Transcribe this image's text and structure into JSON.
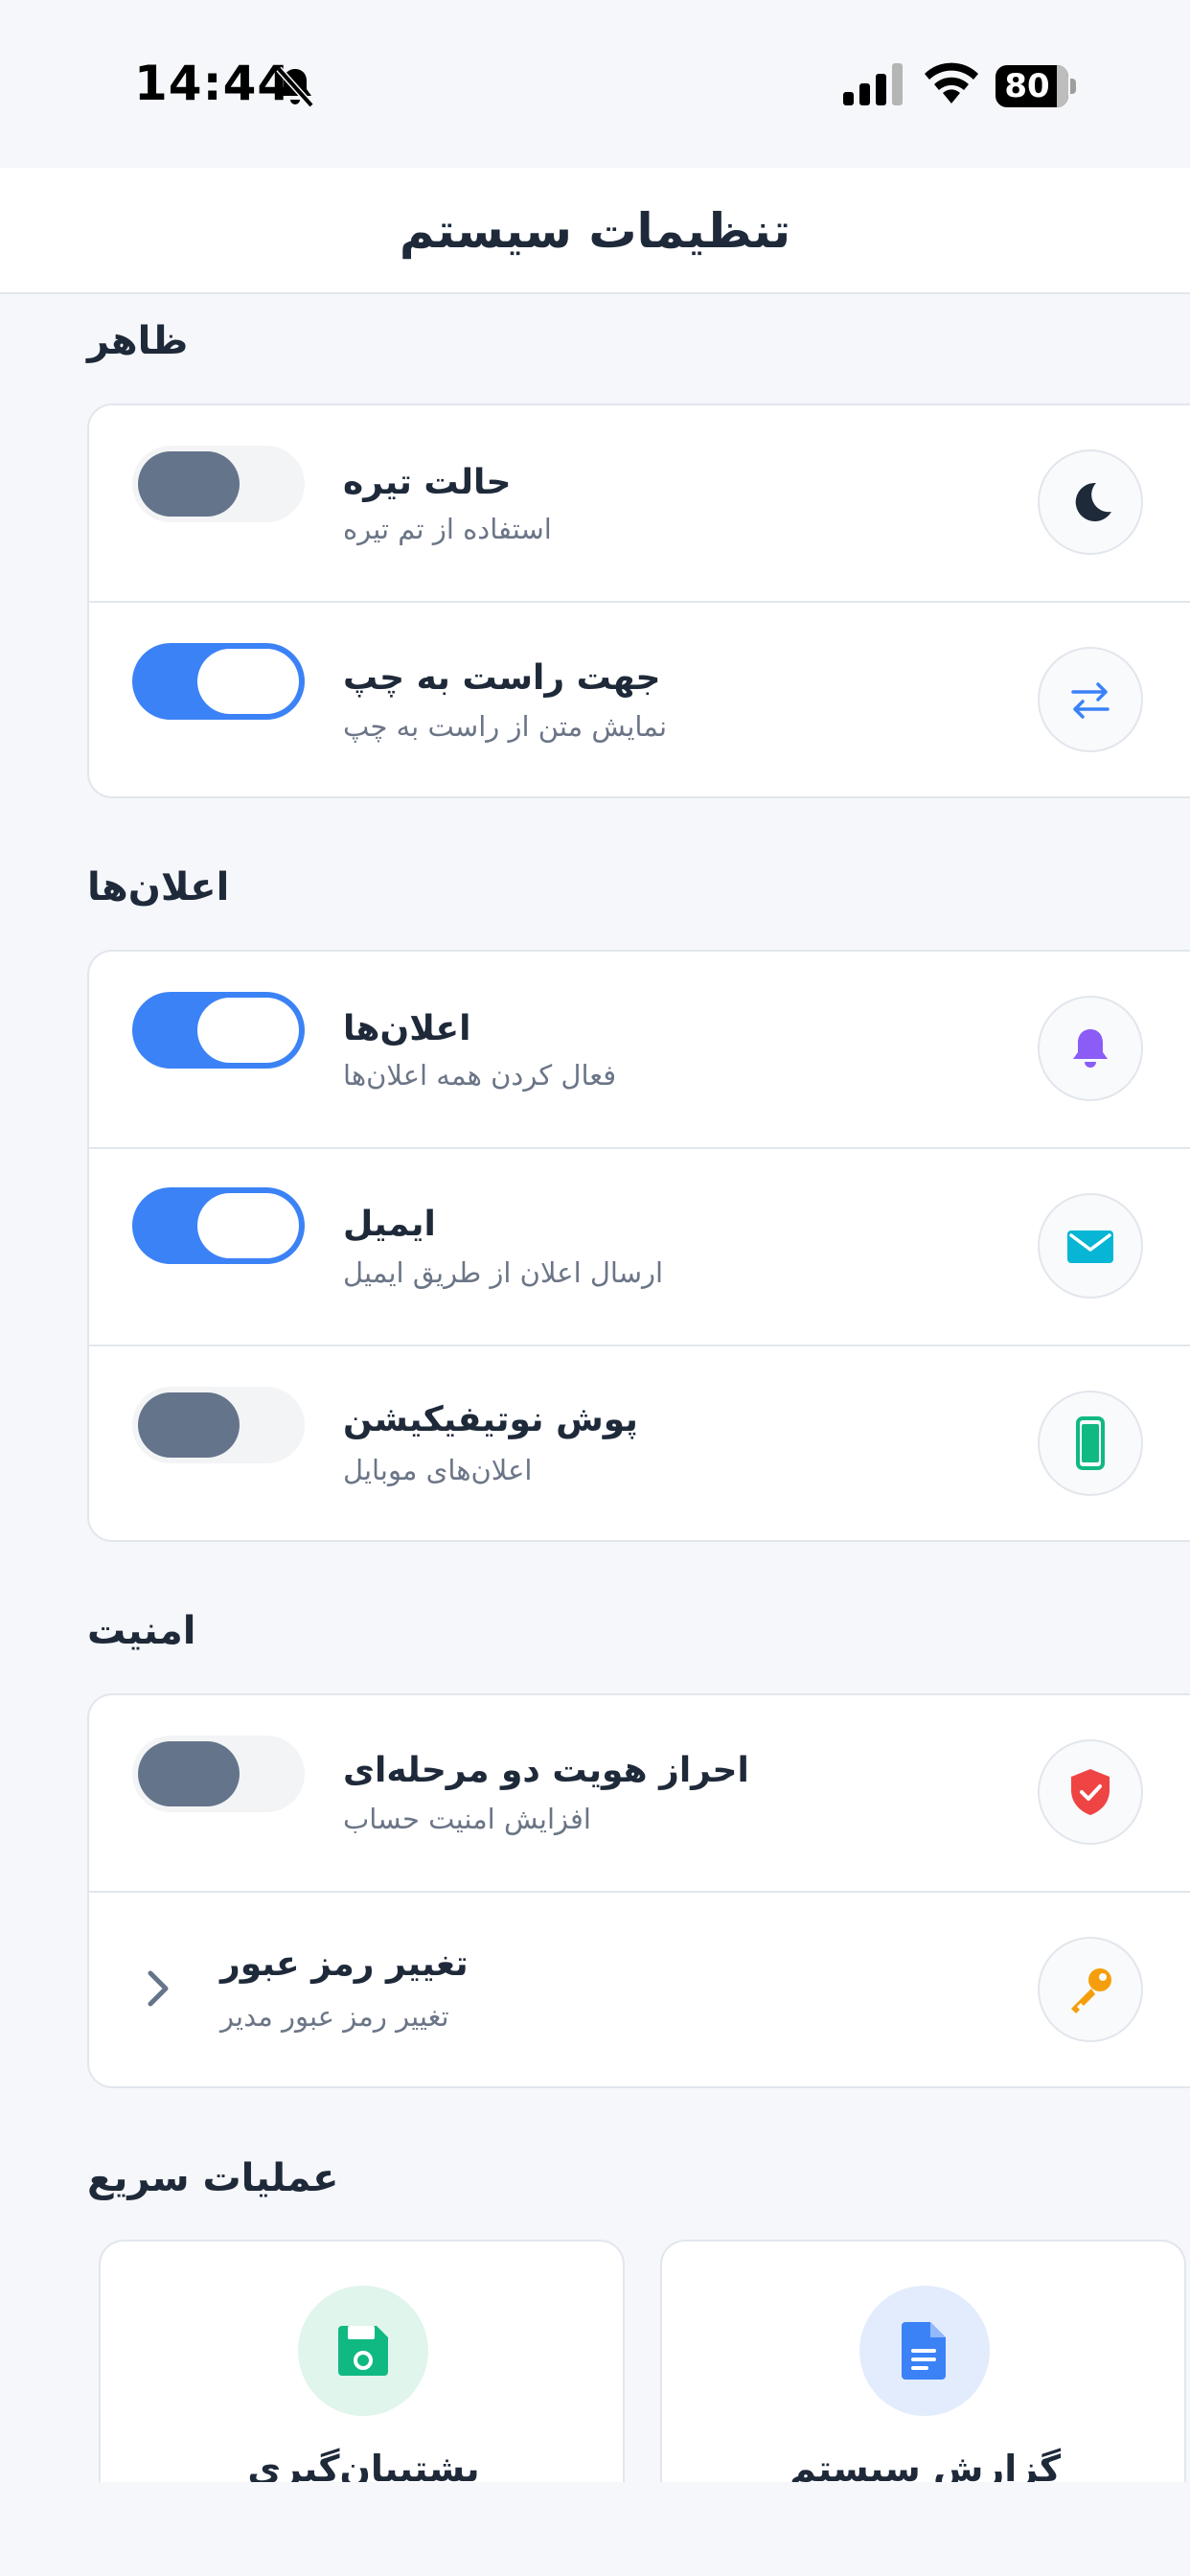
{
  "status_bar": {
    "time": "14:44",
    "battery": "80",
    "icons": [
      "bell-off-icon",
      "signal-icon",
      "wifi-icon",
      "battery-icon"
    ]
  },
  "header": {
    "title": "تنظیمات سیستم"
  },
  "appearance": {
    "title": "ظاهر",
    "items": [
      {
        "title": "حالت تیره",
        "subtitle": "استفاده از تم تیره",
        "icon": "moon-icon",
        "toggle_on": false,
        "icon_color": "#1e2939"
      },
      {
        "title": "جهت راست به چپ",
        "subtitle": "نمایش متن از راست به چپ",
        "icon": "swap-arrows-icon",
        "toggle_on": true,
        "icon_color": "#3b82f6"
      }
    ]
  },
  "notifications": {
    "title": "اعلان‌ها",
    "items": [
      {
        "title": "اعلان‌ها",
        "subtitle": "فعال کردن همه اعلان‌ها",
        "icon": "bell-icon",
        "toggle_on": true,
        "icon_color": "#8b5cf6"
      },
      {
        "title": "ایمیل",
        "subtitle": "ارسال اعلان از طریق ایمیل",
        "icon": "mail-icon",
        "toggle_on": true,
        "icon_color": "#06b6d4"
      },
      {
        "title": "پوش نوتیفیکیشن",
        "subtitle": "اعلان‌های موبایل",
        "icon": "mobile-icon",
        "toggle_on": false,
        "icon_color": "#10b981"
      }
    ]
  },
  "security": {
    "title": "امنیت",
    "items": [
      {
        "title": "احراز هویت دو مرحله‌ای",
        "subtitle": "افزایش امنیت حساب",
        "icon": "shield-check-icon",
        "toggle_on": false,
        "icon_color": "#ef4444"
      },
      {
        "title": "تغییر رمز عبور",
        "subtitle": "تغییر رمز عبور مدیر",
        "icon": "key-icon",
        "icon_color": "#f59e0b",
        "action": "chevron-left-icon"
      }
    ]
  },
  "quick_actions": {
    "title": "عملیات سریع",
    "items": [
      {
        "label": "گزارش سیستم",
        "icon": "document-icon",
        "icon_color": "#3b82f6",
        "bg_color": "#e3ecfd"
      },
      {
        "label": "پشتیبان‌گیری",
        "icon": "save-icon",
        "icon_color": "#10b981",
        "bg_color": "#e0f5ec"
      }
    ]
  },
  "colors": {
    "accent": "#3b82f6",
    "background": "#f5f7fa",
    "toggle_off_knob": "#64748b"
  }
}
